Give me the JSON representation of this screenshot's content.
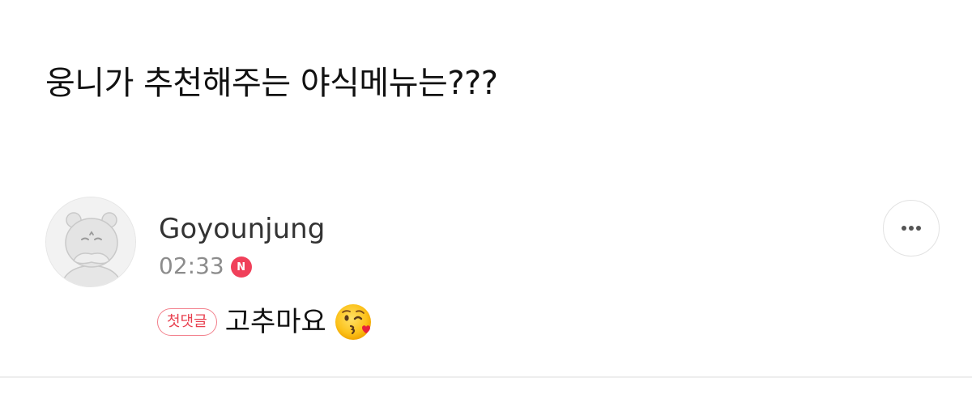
{
  "post": {
    "question": "웅니가 추천해주는 야식메뉴는???"
  },
  "comment": {
    "author": "Goyounjung",
    "time": "02:33",
    "new_badge": "N",
    "first_comment_badge": "첫댓글",
    "text": "고추마요",
    "emoji": "kissing-face-with-heart-emoji",
    "avatar": "bear-character-avatar",
    "more_icon": "more-horizontal-icon"
  },
  "colors": {
    "new_badge": "#f0405a",
    "first_comment_border": "#f27f8b",
    "first_comment_text": "#e8404f",
    "time": "#8c8c8c"
  }
}
